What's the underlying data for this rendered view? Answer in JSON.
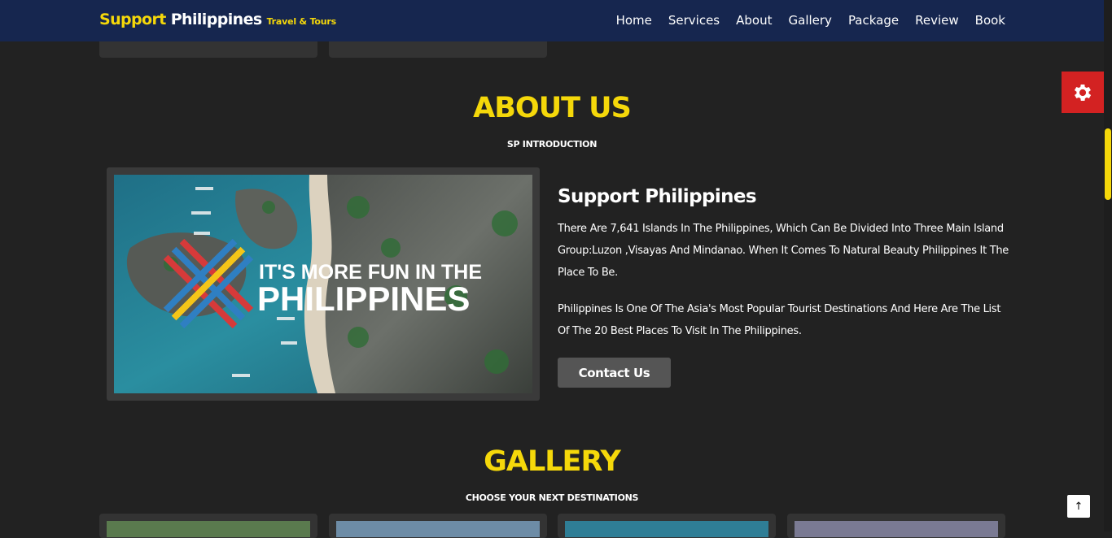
{
  "brand": {
    "part1": "Support",
    "part2": "Philippines",
    "part3": "Travel & Tours"
  },
  "nav": [
    "Home",
    "Services",
    "About",
    "Gallery",
    "Package",
    "Review",
    "Book"
  ],
  "about": {
    "heading": "ABOUT US",
    "subheading": "SP INTRODUCTION",
    "image_text_line1": "IT'S MORE FUN IN THE",
    "image_text_line2": "PHILIPPINES",
    "title": "Support Philippines",
    "paragraph1": "There Are 7,641 Islands In The Philippines, Which Can Be Divided Into Three Main Island Group:Luzon ,Visayas And Mindanao. When It Comes To Natural Beauty Philippines It The Place To Be.",
    "paragraph2": "Philippines Is One Of The Asia's Most Popular Tourist Destinations And Here Are The List Of The 20 Best Places To Visit In The Philippines.",
    "button": "Contact Us"
  },
  "gallery": {
    "heading": "GALLERY",
    "subheading": "CHOOSE YOUR NEXT DESTINATIONS"
  },
  "icons": {
    "settings": "gear-icon",
    "scroll_top": "arrow-up-icon"
  },
  "colors": {
    "accent": "#f5d80a",
    "navbar": "#16264f",
    "background": "#222222",
    "settings": "#d32222"
  }
}
